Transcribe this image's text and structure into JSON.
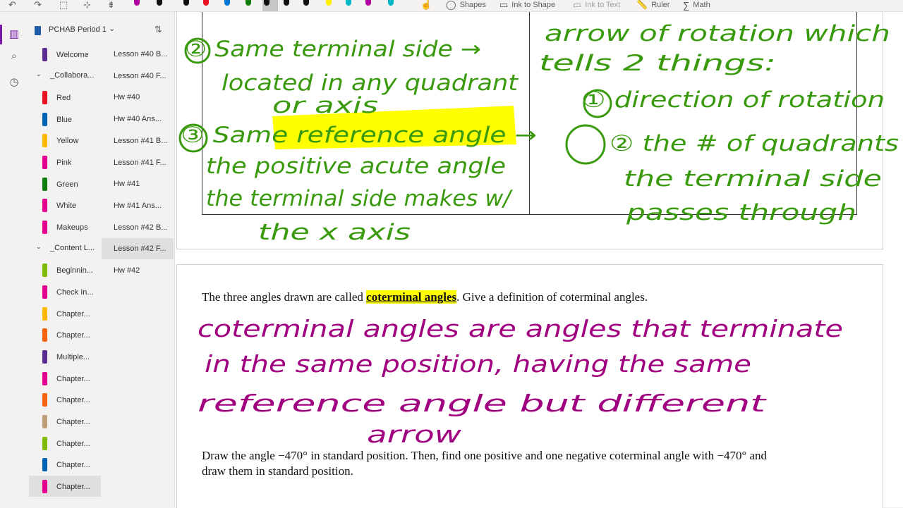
{
  "toolbar": {
    "undo": "↶",
    "redo": "↷",
    "tools": {
      "shapes": "Shapes",
      "ink_to_shape": "Ink to Shape",
      "ink_to_text": "Ink to Text",
      "ruler": "Ruler",
      "math": "Math"
    },
    "pen_colors": [
      "#b4009e",
      "#111111",
      "#111111",
      "#e81123",
      "#0078d4",
      "#107c10",
      "#111111",
      "#111111",
      "#111111",
      "#fff100",
      "#00b7c3",
      "#b4009e",
      "#00b7c3"
    ]
  },
  "notebook": {
    "title": "PCHAB Period 1"
  },
  "sections": [
    {
      "label": "Welcome",
      "color": "#5c2d91"
    },
    {
      "label": "_Collabora...",
      "group": true
    },
    {
      "label": "Red",
      "color": "#e81123"
    },
    {
      "label": "Blue",
      "color": "#0063b1"
    },
    {
      "label": "Yellow",
      "color": "#ffb900"
    },
    {
      "label": "Pink",
      "color": "#e3008c"
    },
    {
      "label": "Green",
      "color": "#107c10"
    },
    {
      "label": "White",
      "color": "#e3008c"
    },
    {
      "label": "Makeups",
      "color": "#e3008c"
    },
    {
      "label": "_Content L...",
      "group": true
    },
    {
      "label": "Beginnin...",
      "color": "#7fba00"
    },
    {
      "label": "Check In...",
      "color": "#e3008c"
    },
    {
      "label": "Chapter...",
      "color": "#ffb900"
    },
    {
      "label": "Chapter...",
      "color": "#f7630c"
    },
    {
      "label": "Multiple...",
      "color": "#5c2d91"
    },
    {
      "label": "Chapter...",
      "color": "#e3008c"
    },
    {
      "label": "Chapter...",
      "color": "#f7630c"
    },
    {
      "label": "Chapter...",
      "color": "#c19c79"
    },
    {
      "label": "Chapter...",
      "color": "#7fba00"
    },
    {
      "label": "Chapter...",
      "color": "#0063b1"
    },
    {
      "label": "Chapter...",
      "color": "#e3008c",
      "selected": true
    }
  ],
  "pages": [
    {
      "label": "Lesson #40 B..."
    },
    {
      "label": "Lesson #40 F..."
    },
    {
      "label": "Hw #40"
    },
    {
      "label": "Hw #40 Ans..."
    },
    {
      "label": "Lesson #41 B..."
    },
    {
      "label": "Lesson #41 F..."
    },
    {
      "label": "Hw #41"
    },
    {
      "label": "Hw #41 Ans..."
    },
    {
      "label": "Lesson #42 B..."
    },
    {
      "label": "Lesson #42 F...",
      "selected": true
    },
    {
      "label": "Hw #42"
    }
  ],
  "content": {
    "q1_before": "The three angles drawn are called ",
    "q1_term": "coterminal angles",
    "q1_after": ".  Give a definition of coterminal angles.",
    "q2_line1": "Draw the angle −470° in standard position.  Then, find one positive and one negative coterminal angle with −470° and",
    "q2_line2": "draw them in standard position."
  },
  "ink": {
    "green_color": "#3a9a0e",
    "purple_color": "#a0007f",
    "left": [
      "② Same terminal side →",
      "located in any quadrant",
      "or axis",
      "③ Same reference angle →",
      "the positive acute angle",
      "the terminal side makes w/",
      "the x axis"
    ],
    "right": [
      "arrow of rotation which",
      "tells 2 things:",
      "① direction of rotation",
      "② the # of quadrants",
      "the terminal side",
      "passes through"
    ],
    "answer": [
      "coterminal angles are angles that terminate",
      "in the same position, having the same",
      "reference angle but different",
      "arrow"
    ]
  }
}
